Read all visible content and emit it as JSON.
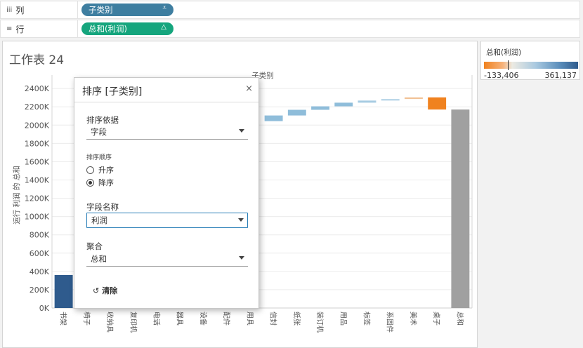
{
  "shelves": {
    "columns": {
      "label": "列",
      "icon": "iii",
      "pill": "子类别",
      "pill_color": "#3e7ea0"
    },
    "rows": {
      "label": "行",
      "icon": "≡",
      "pill": "总和(利润)",
      "pill_color": "#15a57d"
    }
  },
  "sheet_title": "工作表 24",
  "legend": {
    "title": "总和(利润)",
    "min": "-133,406",
    "max": "361,137"
  },
  "chart_data": {
    "type": "bar",
    "title": "子类别",
    "xlabel": "",
    "ylabel": "运行 利润 的 总和",
    "ylim": [
      0,
      2470000
    ],
    "yticks": [
      "0K",
      "200K",
      "400K",
      "600K",
      "800K",
      "1000K",
      "1200K",
      "1400K",
      "1600K",
      "1800K",
      "2000K",
      "2200K",
      "2400K"
    ],
    "categories": [
      "书架",
      "椅子",
      "收纳具",
      "复印机",
      "电话",
      "器具",
      "设备",
      "配件",
      "用具",
      "信封",
      "纸张",
      "装订机",
      "用品",
      "标签",
      "系固件",
      "美术",
      "桌子",
      "总和"
    ],
    "steps": [
      {
        "from": 0,
        "to": 361137,
        "color": "#2f5b8d"
      },
      {
        "from": 2043000,
        "to": 2105000,
        "color": "#8fbdda"
      },
      {
        "from": 2105000,
        "to": 2167000,
        "color": "#8fbdda"
      },
      {
        "from": 2167000,
        "to": 2205000,
        "color": "#8fbdda"
      },
      {
        "from": 2205000,
        "to": 2245000,
        "color": "#8fbdda"
      },
      {
        "from": 2245000,
        "to": 2268000,
        "color": "#a6cbe2"
      },
      {
        "from": 2268000,
        "to": 2285000,
        "color": "#b5d4e8"
      },
      {
        "from": 2285000,
        "to": 2303000,
        "color": "#f2c397"
      },
      {
        "from": 2303000,
        "to": 2170000,
        "color": "#f0821f"
      },
      {
        "from": 0,
        "to": 2170000,
        "color": "#a0a0a0"
      }
    ]
  },
  "dialog": {
    "title": "排序 [子类别]",
    "close": "×",
    "sort_by_label": "排序依据",
    "sort_by_value": "字段",
    "order_label": "排序顺序",
    "asc": "升序",
    "desc": "降序",
    "field_label": "字段名称",
    "field_value": "利润",
    "agg_label": "聚合",
    "agg_value": "总和",
    "clear": "清除"
  }
}
